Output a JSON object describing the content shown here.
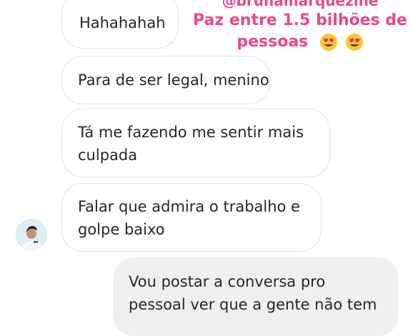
{
  "overlay": {
    "handle": "@brunamarquezine",
    "caption_line1": "Paz entre 1.5 bilhões de",
    "caption_line2": "pessoas",
    "emoji_icons": [
      "heart-eyes-emoji-icon",
      "heart-eyes-emoji-icon"
    ],
    "color": "#e8488a"
  },
  "messages": [
    {
      "direction": "received",
      "lines": [
        "Hahahahah"
      ]
    },
    {
      "direction": "received",
      "lines": [
        "Para de ser legal, menino"
      ]
    },
    {
      "direction": "received",
      "lines": [
        "Tá me fazendo me sentir mais",
        "culpada"
      ]
    },
    {
      "direction": "received",
      "lines": [
        "Falar que admira o trabalho e",
        "golpe baixo"
      ]
    },
    {
      "direction": "sent",
      "lines": [
        "Vou postar a conversa pro",
        "pessoal ver que a gente não tem"
      ]
    }
  ],
  "colors": {
    "received_bubble_border": "#e4e4e4",
    "sent_bubble_background": "#efefef",
    "text": "#262626"
  }
}
